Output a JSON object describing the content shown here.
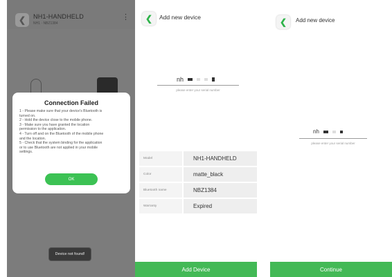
{
  "screen1": {
    "device_name": "NH1-HANDHELD",
    "device_sub": "NH1 · NBZ1384",
    "menu_icon": "kebab-icon",
    "dialog": {
      "title": "Connection Failed",
      "lines": [
        "1 - Please make sure that your device's Bluetooth is",
        "turned on.",
        "2 - Hold the device close to the mobile phone.",
        "3 - Make sure you have granted the location",
        "permission to the application.",
        "4 - Turn off and on the Bluetooth of the mobile phone",
        "and the location.",
        "5 - Check that the system binding for the application",
        "or to use Bluetooth are not applied in your mobile",
        "settings."
      ],
      "ok_label": "OK"
    },
    "toast": "Device not found!"
  },
  "screen2": {
    "title": "Add new device",
    "serial_prefix": "nh",
    "serial_hint": "please enter your serial number",
    "info": [
      {
        "key": "Model",
        "value": "NH1-HANDHELD"
      },
      {
        "key": "Color",
        "value": "matte_black"
      },
      {
        "key": "Bluetooth name",
        "value": "NBZ1384"
      },
      {
        "key": "Warranty",
        "value": "Expired"
      }
    ],
    "button": "Add Device"
  },
  "screen3": {
    "title": "Add new device",
    "serial_prefix": "nh",
    "serial_hint": "please enter your serial number",
    "button": "Continue"
  },
  "colors": {
    "accent": "#43b956",
    "overlay": "#7c7c7c"
  }
}
